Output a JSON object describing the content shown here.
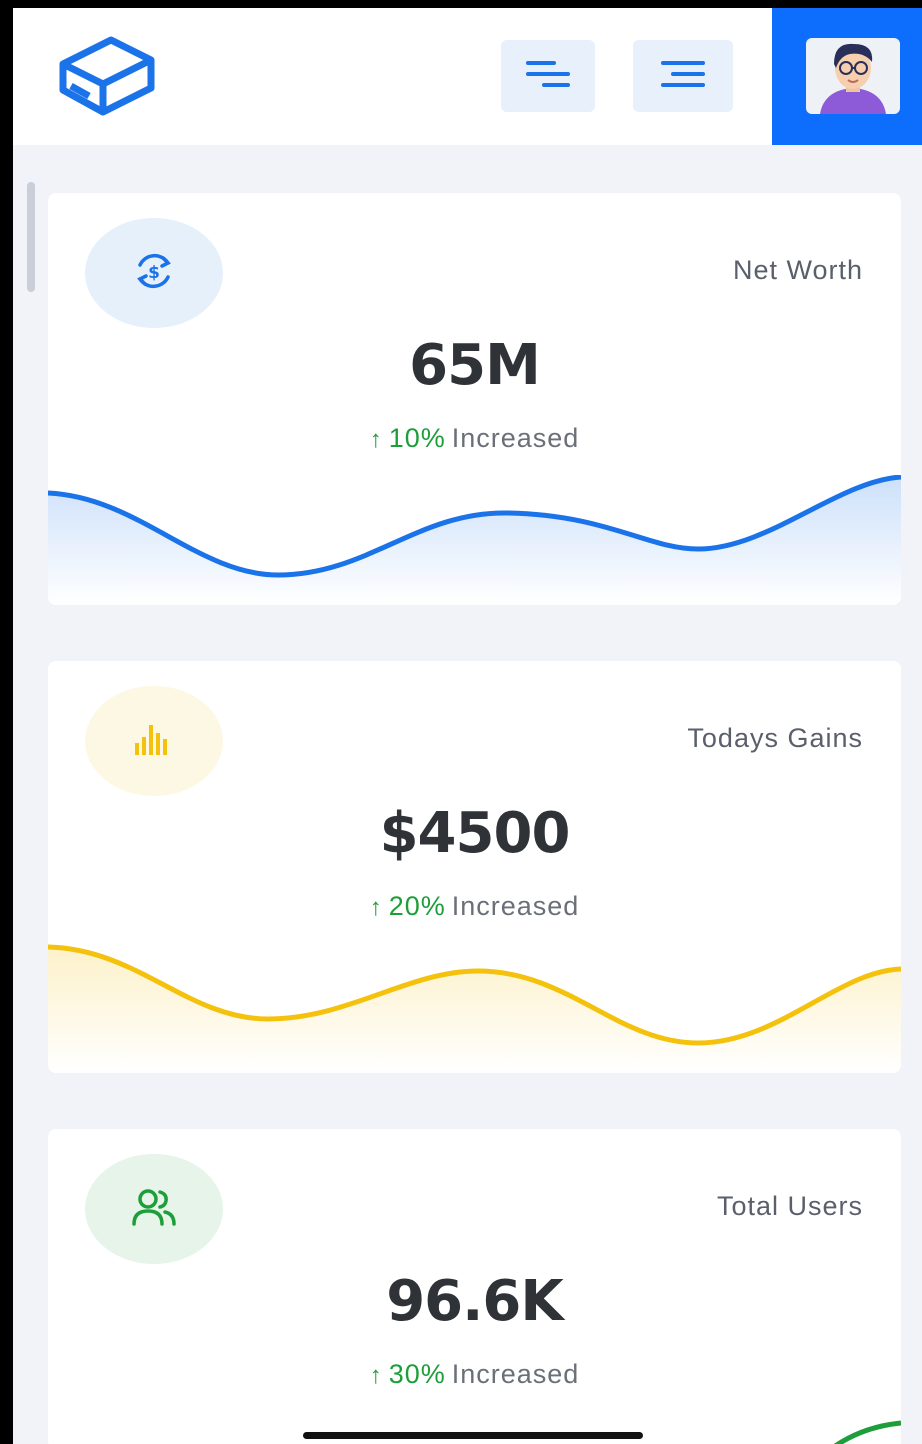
{
  "header": {
    "logo_icon": "box-logo-icon",
    "buttons": [
      {
        "icon": "sliders-menu-icon"
      },
      {
        "icon": "hamburger-menu-icon"
      }
    ],
    "avatar_icon": "user-avatar-icon",
    "accent_color": "#0d6efd"
  },
  "cards": [
    {
      "title": "Net Worth",
      "value": "65M",
      "trend_percent": "10%",
      "trend_label": "Increased",
      "icon": "dollar-exchange-icon",
      "color": "#1a73e8",
      "icon_bg": "#e6f0fb"
    },
    {
      "title": "Todays Gains",
      "value": "$4500",
      "trend_percent": "20%",
      "trend_label": "Increased",
      "icon": "bar-chart-icon",
      "color": "#f4c20d",
      "icon_bg": "#fdf8e3"
    },
    {
      "title": "Total Users",
      "value": "96.6K",
      "trend_percent": "30%",
      "trend_label": "Increased",
      "icon": "users-icon",
      "color": "#1e9e3a",
      "icon_bg": "#e6f4ea"
    }
  ],
  "trend_arrow": "↑"
}
